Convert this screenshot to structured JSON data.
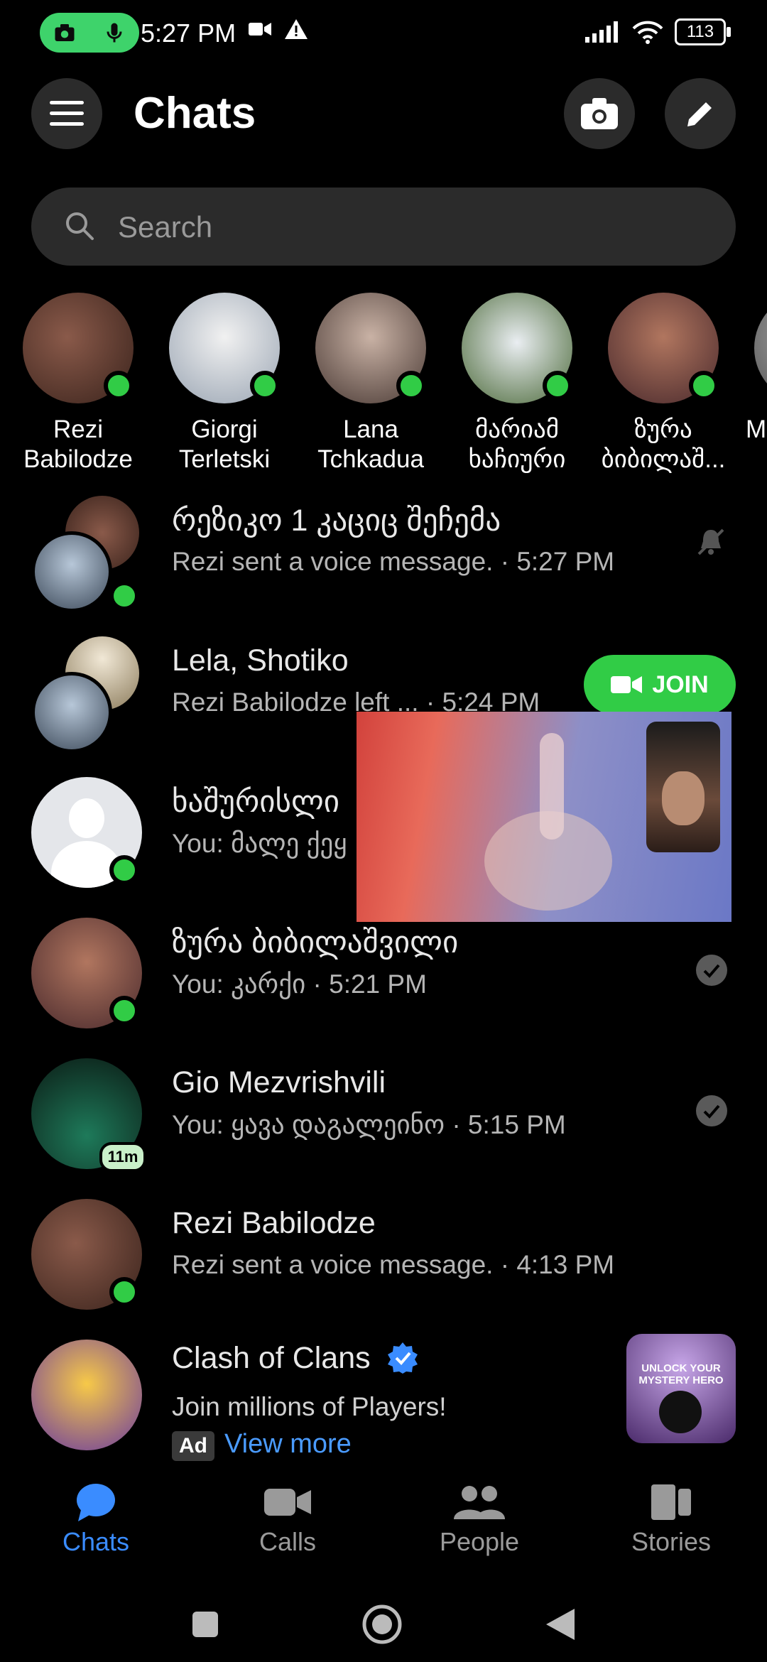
{
  "status_bar": {
    "time": "5:27 PM",
    "battery": "113"
  },
  "header": {
    "title": "Chats"
  },
  "search": {
    "placeholder": "Search"
  },
  "stories": [
    {
      "name": "Rezi\nBabilodze",
      "color": "#5e3a2f"
    },
    {
      "name": "Giorgi\nTerletski",
      "color": "#c9cfd8"
    },
    {
      "name": "Lana\nTchkadua",
      "color": "#7a6a62"
    },
    {
      "name": "მარიამ\nხაჩიური",
      "color": "#4c6a3a"
    },
    {
      "name": "ზურა\nბიბილაშ...",
      "color": "#8a4a45"
    },
    {
      "name": "Ma",
      "color": "#888888"
    }
  ],
  "chats": [
    {
      "name": "რეზიკო 1 კაციც შეჩემა",
      "message": "Rezi sent a voice message. · 5:27 PM",
      "trailing": "muted-bell-icon"
    },
    {
      "name": "Lela, Shotiko",
      "message": "Rezi Babilodze left ... · 5:24 PM",
      "trailing": "join"
    },
    {
      "name": "ხაშურისლი",
      "message": "You: მალე ქეყ",
      "trailing": "check"
    },
    {
      "name": "ზურა ბიბილაშვილი",
      "message": "You: კარქი · 5:21 PM",
      "trailing": "check"
    },
    {
      "name": "Gio Mezvrishvili",
      "message": "You: ყავა დაგალეინო · 5:15 PM",
      "trailing": "check",
      "badge": "11m"
    },
    {
      "name": "Rezi Babilodze",
      "message": "Rezi sent a voice message. · 4:13 PM",
      "trailing": ""
    }
  ],
  "join_label": "JOIN",
  "ad": {
    "name": "Clash of Clans",
    "text": "Join millions of Players!",
    "badge": "Ad",
    "link": "View more",
    "thumb_text": "UNLOCK YOUR MYSTERY HERO"
  },
  "tabs": [
    {
      "label": "Chats",
      "active": true
    },
    {
      "label": "Calls"
    },
    {
      "label": "People"
    },
    {
      "label": "Stories"
    }
  ],
  "colors": {
    "accent": "#3a8cff",
    "online": "#31cc46",
    "surface": "#2b2b2b"
  }
}
